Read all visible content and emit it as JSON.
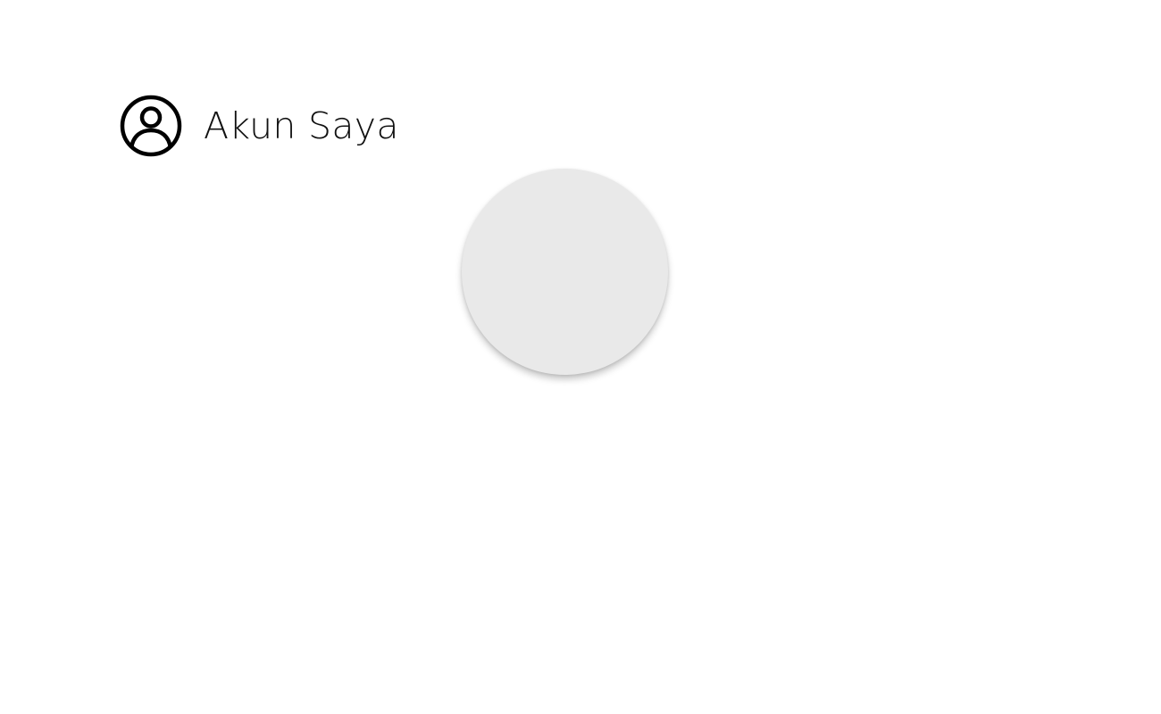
{
  "header": {
    "icon": "account-circle-icon",
    "title": "Akun Saya"
  },
  "profile": {
    "avatar_color": "#e9e9e9"
  }
}
